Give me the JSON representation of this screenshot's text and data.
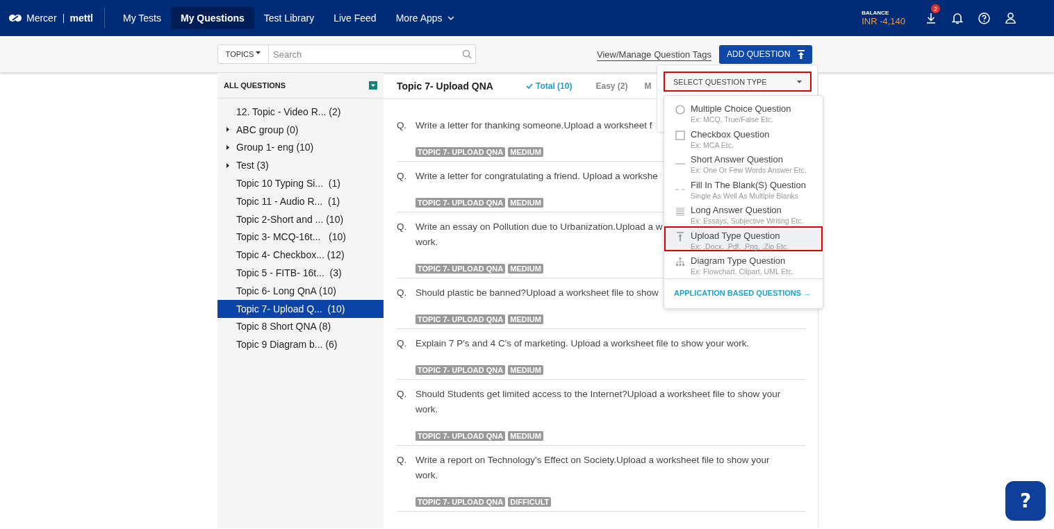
{
  "nav": {
    "brand": "Mercer",
    "product": "mettl",
    "tabs": [
      {
        "label": "My Tests",
        "selected": false,
        "kind": "link"
      },
      {
        "label": "My Questions",
        "selected": true,
        "kind": "link"
      },
      {
        "label": "Test Library",
        "selected": false,
        "kind": "link"
      },
      {
        "label": "Live Feed",
        "selected": false,
        "kind": "link"
      },
      {
        "label": "More Apps",
        "selected": false,
        "kind": "menu"
      }
    ],
    "balance_label": "BALANCE",
    "balance": "INR -4,140",
    "downloads_badge": "2"
  },
  "toolbar": {
    "topics_button": "TOPICS",
    "search": {
      "placeholder": "Search"
    },
    "tags_link": "View/Manage Question Tags",
    "add_button": "ADD QUESTION"
  },
  "sidebar": {
    "title": "ALL QUESTIONS",
    "items": [
      {
        "label": "12. Topic - Video R... (2)",
        "kind": "topic",
        "selected": false
      },
      {
        "label": "ABC group (0)",
        "kind": "group",
        "selected": false
      },
      {
        "label": "Group 1- eng (10)",
        "kind": "group",
        "selected": false
      },
      {
        "label": "Test (3)",
        "kind": "group",
        "selected": false
      },
      {
        "label": "Topic 10 Typing Si...  (1)",
        "kind": "topic",
        "selected": false
      },
      {
        "label": "Topic 11 - Audio R...  (1)",
        "kind": "topic",
        "selected": false
      },
      {
        "label": "Topic 2-Short and ... (10)",
        "kind": "topic",
        "selected": false
      },
      {
        "label": "Topic 3- MCQ-16t...   (10)",
        "kind": "topic",
        "selected": false
      },
      {
        "label": "Topic 4- Checkbox... (12)",
        "kind": "topic",
        "selected": false
      },
      {
        "label": "Topic 5 - FITB- 16t...  (3)",
        "kind": "topic",
        "selected": false
      },
      {
        "label": "Topic 6- Long QnA (10)",
        "kind": "topic",
        "selected": false
      },
      {
        "label": "Topic 7- Upload Q...  (10)",
        "kind": "topic",
        "selected": true
      },
      {
        "label": "Topic 8 Short QNA (8)",
        "kind": "topic",
        "selected": false
      },
      {
        "label": "Topic 9 Diagram b... (6)",
        "kind": "topic",
        "selected": false
      }
    ]
  },
  "main": {
    "title": "Topic 7- Upload QNA",
    "filters": [
      {
        "label": "Total (10)",
        "selected": true
      },
      {
        "label": "Easy (2)",
        "selected": false
      },
      {
        "label": "M",
        "selected": false
      }
    ],
    "questions": [
      {
        "marker": "Q.",
        "lines": [
          "Write a letter for thanking someone.Upload a worksheet f"
        ],
        "tags": [
          "TOPIC 7- UPLOAD QNA",
          "MEDIUM"
        ]
      },
      {
        "marker": "Q.",
        "lines": [
          "Write a letter for congratulating a friend. Upload a workshe"
        ],
        "tags": [
          "TOPIC 7- UPLOAD QNA",
          "MEDIUM"
        ]
      },
      {
        "marker": "Q.",
        "lines": [
          "Write an essay on Pollution due to Urbanization.Upload a w",
          "work."
        ],
        "tags": [
          "TOPIC 7- UPLOAD QNA",
          "MEDIUM"
        ]
      },
      {
        "marker": "Q.",
        "lines": [
          "Should plastic be banned?Upload a worksheet file to show"
        ],
        "tags": [
          "TOPIC 7- UPLOAD QNA",
          "MEDIUM"
        ]
      },
      {
        "marker": "Q.",
        "lines": [
          "Explain 7 P's and 4 C's of marketing. Upload a worksheet file to show your work."
        ],
        "tags": [
          "TOPIC 7- UPLOAD QNA",
          "MEDIUM"
        ]
      },
      {
        "marker": "Q.",
        "lines": [
          "Should Students get limited access to the Internet?Upload a worksheet file to show your",
          "work."
        ],
        "tags": [
          "TOPIC 7- UPLOAD QNA",
          "MEDIUM"
        ]
      },
      {
        "marker": "Q.",
        "lines": [
          "Write a report on Technology's Effect on Society.Upload a worksheet file to show your",
          "work."
        ],
        "tags": [
          "TOPIC 7- UPLOAD QNA",
          "DIFFICULT"
        ]
      }
    ]
  },
  "question_type_menu": {
    "select": "SELECT QUESTION TYPE",
    "options": [
      {
        "kind": "radio",
        "label": "Multiple Choice Question",
        "hint": "Ex: MCQ, True/False Etc.",
        "selected": false
      },
      {
        "kind": "checkbox",
        "label": "Checkbox Question",
        "hint": "Ex: MCA Etc.",
        "selected": false
      },
      {
        "kind": "short",
        "label": "Short Answer Question",
        "hint": "Ex: One Or Few Words Answer Etc.",
        "selected": false
      },
      {
        "kind": "blank",
        "label": "Fill In The Blank(S) Question",
        "hint": "Single As Well As Multiple Blanks",
        "selected": false
      },
      {
        "kind": "long",
        "label": "Long Answer Question",
        "hint": "Ex: Essays, Subjective Writing Etc.",
        "selected": false
      },
      {
        "kind": "upload",
        "label": "Upload Type Question",
        "hint": "Ex: .Docx, .Pdf, .Png, .Zip Etc.",
        "selected": true
      },
      {
        "kind": "diagram",
        "label": "Diagram Type Question",
        "hint": "Ex: Flowchart, Clipart, UML Etc.",
        "selected": false
      }
    ],
    "footer_link": "APPLICATION BASED QUESTIONS →"
  },
  "help_button": "?"
}
